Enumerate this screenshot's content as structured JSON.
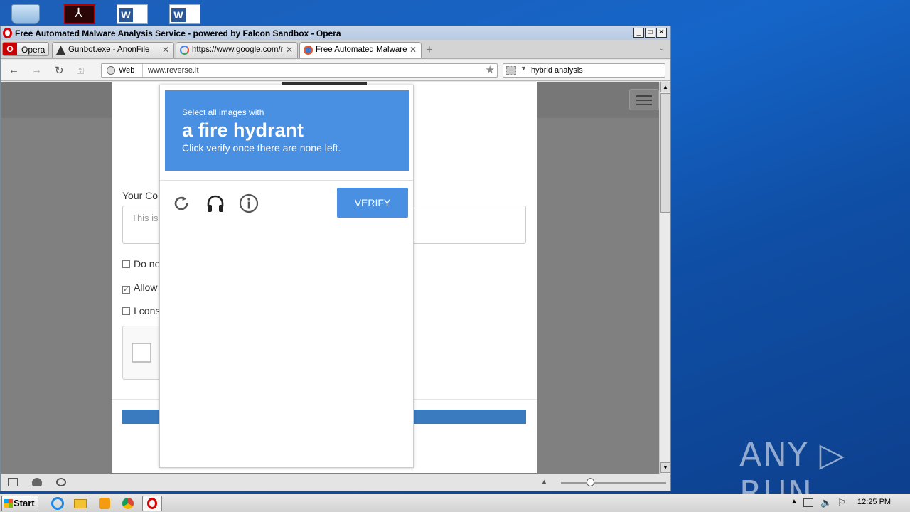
{
  "window": {
    "title": "Free Automated Malware Analysis Service - powered by Falcon Sandbox - Opera",
    "controls": {
      "minimize": "_",
      "maximize": "□",
      "close": "✕"
    }
  },
  "opera_menu": {
    "label": "Opera"
  },
  "tabs": [
    {
      "label": "Gunbot.exe - AnonFile",
      "close": "✕",
      "active": false
    },
    {
      "label": "https://www.google.com/recaptcha",
      "close": "✕",
      "active": false
    },
    {
      "label": "Free Automated Malware Analysis Service",
      "close": "✕",
      "active": true
    }
  ],
  "new_tab": "+",
  "navbar": {
    "back": "←",
    "forward": "→",
    "reload": "↻",
    "web_label": "Web",
    "url": "www.reverse.it",
    "search_text": "hybrid analysis"
  },
  "page": {
    "comment_label": "Your Cor",
    "comment_placeholder": "This is",
    "checkbox1_label": "Do no",
    "checkbox2_label": "Allow",
    "checkbox3_label": "I cons",
    "checkbox2_checked": true
  },
  "captcha": {
    "line1": "Select all images with",
    "line2": "a fire hydrant",
    "line3": "Click verify once there are none left.",
    "verify_label": "VERIFY"
  },
  "scrollbar": {
    "up": "▲",
    "down": "▼"
  },
  "watermark": "ANY ▷ RUN",
  "taskbar": {
    "start_label": "Start",
    "clock": "12:25 PM"
  },
  "colors": {
    "captcha_blue": "#4a90e2",
    "submit_blue": "#3a7abf",
    "desktop_blue": "#1565c8"
  }
}
